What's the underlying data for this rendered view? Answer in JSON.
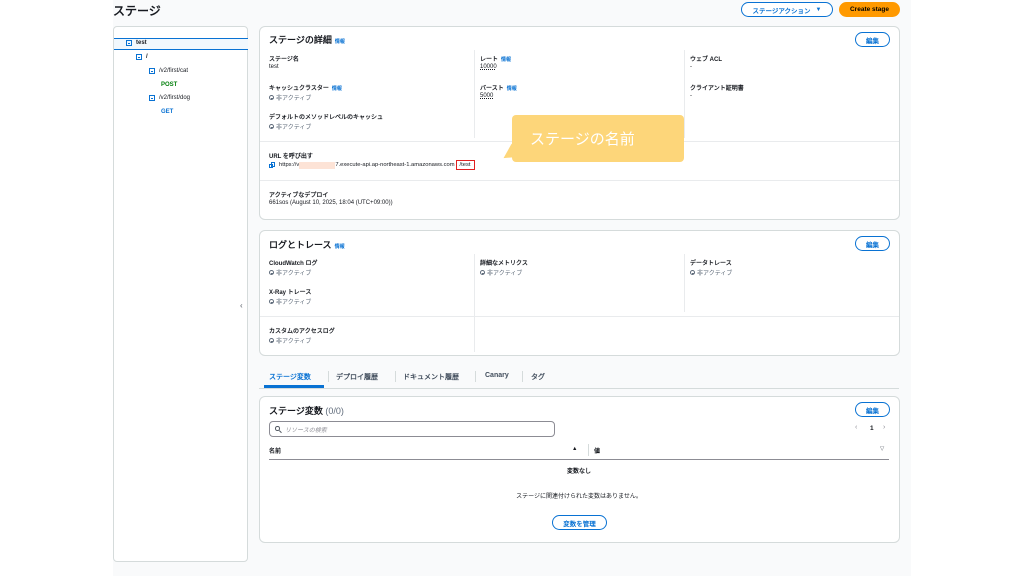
{
  "page": {
    "title": "ステージ",
    "stage_action_label": "ステージアクション",
    "create_stage_label": "Create stage"
  },
  "tree": {
    "root": "test",
    "slash": "/",
    "cat": "/v2/first/cat",
    "cat_method": "POST",
    "dog": "/v2/first/dog",
    "dog_method": "GET"
  },
  "details": {
    "title": "ステージの詳細",
    "info": "情報",
    "edit": "編集",
    "stage_name_label": "ステージ名",
    "stage_name_value": "test",
    "rate_label": "レート",
    "rate_value": "10000",
    "waf_label": "ウェブ ACL",
    "waf_value": "-",
    "cache_label": "キャッシュクラスター",
    "cache_value": "非アクティブ",
    "burst_label": "バースト",
    "burst_value": "5000",
    "cert_label": "クライアント証明書",
    "cert_value": "-",
    "method_cache_label": "デフォルトのメソッドレベルのキャッシュ",
    "method_cache_value": "非アクティブ",
    "invoke_url_label": "URL を呼び出す",
    "invoke_url_prefix": "https://v",
    "invoke_url_mid": "7.execute-api.ap-northeast-1.amazonaws.com",
    "invoke_url_suffix": "/test",
    "deploy_label": "アクティブなデプロイ",
    "deploy_value": "661sos (August 10, 2025, 18:04 (UTC+09:00))"
  },
  "callout": "ステージの名前",
  "logs": {
    "title": "ログとトレース",
    "info": "情報",
    "edit": "編集",
    "cw_label": "CloudWatch ログ",
    "cw_value": "非アクティブ",
    "metrics_label": "詳細なメトリクス",
    "metrics_value": "非アクティブ",
    "trace_label": "データトレース",
    "trace_value": "非アクティブ",
    "xray_label": "X-Ray トレース",
    "xray_value": "非アクティブ",
    "access_label": "カスタムのアクセスログ",
    "access_value": "非アクティブ"
  },
  "tabs": [
    "ステージ変数",
    "デプロイ履歴",
    "ドキュメント履歴",
    "Canary",
    "タグ"
  ],
  "vars": {
    "title": "ステージ変数",
    "count": "(0/0)",
    "edit": "編集",
    "search_placeholder": "リソースの検索",
    "page": "1",
    "col_name": "名前",
    "col_value": "値",
    "empty_title": "変数なし",
    "empty_desc": "ステージに関連付けられた変数はありません。",
    "manage": "変数を管理"
  },
  "colors": {
    "accent": "#0972d3",
    "primary": "#ff9900",
    "post": "#037f0c",
    "callout": "#fdd67a",
    "highlight": "#e02020"
  }
}
